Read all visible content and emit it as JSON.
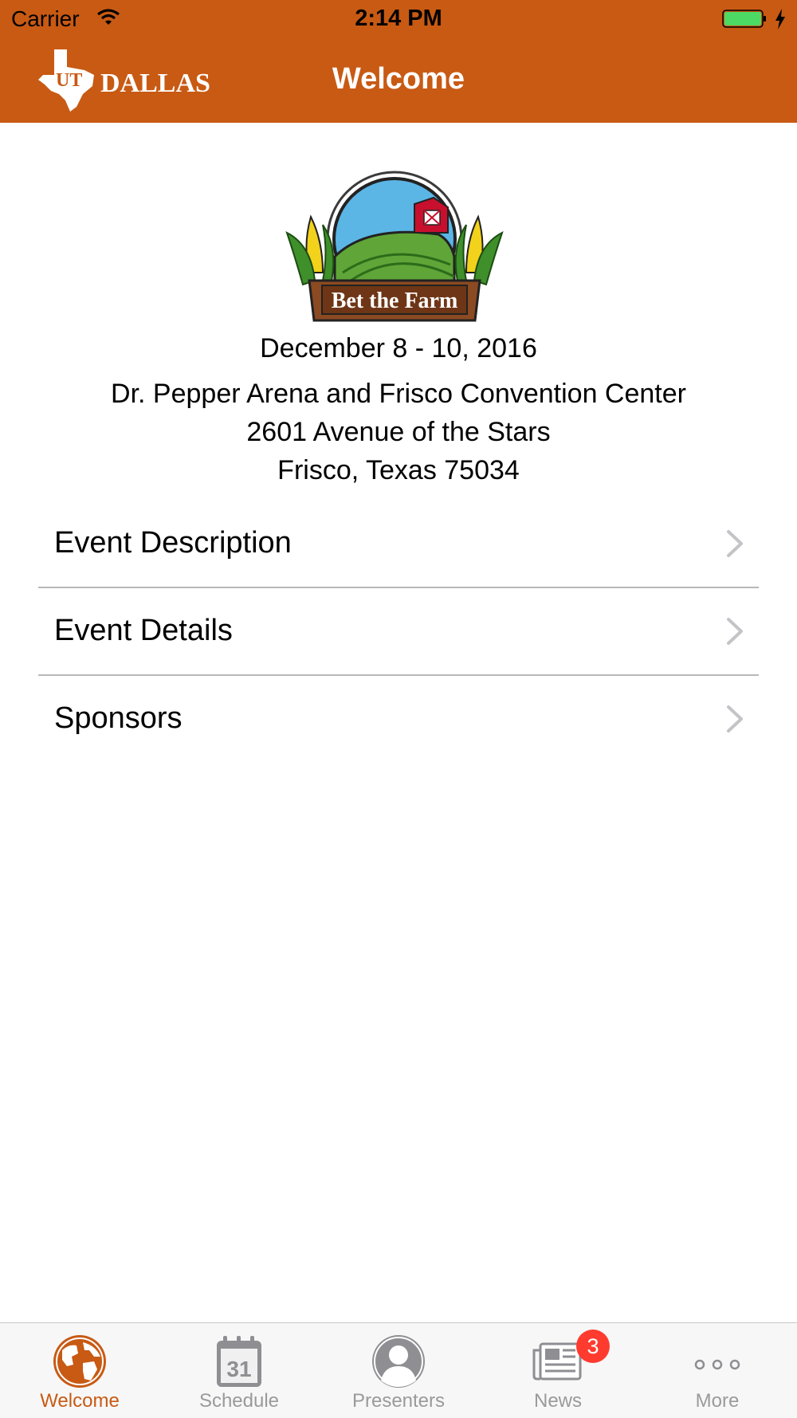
{
  "status_bar": {
    "carrier": "Carrier",
    "time": "2:14 PM"
  },
  "nav": {
    "logo_text": "UT DALLAS",
    "title": "Welcome"
  },
  "emblem": {
    "text": "Bet the Farm"
  },
  "event": {
    "date": "December 8 - 10, 2016",
    "venue": "Dr. Pepper Arena and Frisco Convention Center",
    "street": "2601 Avenue of the Stars",
    "city": "Frisco, Texas 75034"
  },
  "list": {
    "items": [
      {
        "label": "Event Description"
      },
      {
        "label": "Event Details"
      },
      {
        "label": "Sponsors"
      }
    ]
  },
  "tabs": {
    "items": [
      {
        "label": "Welcome",
        "icon": "globe-icon"
      },
      {
        "label": "Schedule",
        "icon": "calendar-icon",
        "day": "31"
      },
      {
        "label": "Presenters",
        "icon": "person-icon"
      },
      {
        "label": "News",
        "icon": "newspaper-icon",
        "badge": "3"
      },
      {
        "label": "More",
        "icon": "more-icon"
      }
    ]
  },
  "colors": {
    "accent": "#c85a14",
    "tab_inactive": "#9a9a9a",
    "badge": "#ff3b30",
    "battery": "#4cd964"
  }
}
